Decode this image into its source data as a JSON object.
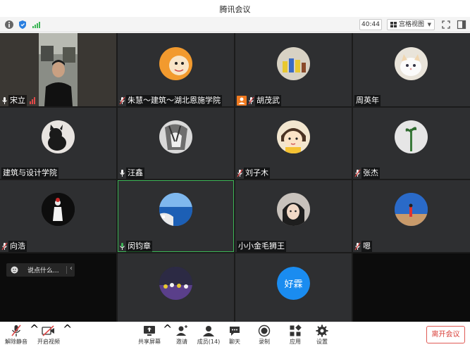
{
  "window": {
    "title": "腾讯会议"
  },
  "toolbar": {
    "icons": [
      "info-icon",
      "shield-icon",
      "signal-icon"
    ],
    "timer": "40:44",
    "layout_label": "宫格视图",
    "right_icons": [
      "fullscreen-icon",
      "sidebar-icon"
    ]
  },
  "participants": [
    {
      "name": "宋立",
      "mic": "on",
      "video": "camera",
      "signal": true
    },
    {
      "name": "朱慧～建筑～湖北恩施学院",
      "mic": "muted",
      "avatar": "orange-cartoon"
    },
    {
      "name": "胡茂武",
      "mic": "muted",
      "host_badge": true,
      "avatar": "figures"
    },
    {
      "name": "周英年",
      "mic": "none",
      "avatar": "cat"
    },
    {
      "name": "建筑与设计学院",
      "mic": "none",
      "avatar": "black-cat"
    },
    {
      "name": "汪鑫",
      "mic": "on",
      "avatar": "anime-bw"
    },
    {
      "name": "刘子木",
      "mic": "muted",
      "avatar": "cartoon-girl"
    },
    {
      "name": "张杰",
      "mic": "muted",
      "avatar": "plant"
    },
    {
      "name": "向浩",
      "mic": "muted",
      "avatar": "dark-figure"
    },
    {
      "name": "闵钧章",
      "mic": "active",
      "avatar": "sea-coast",
      "active_speaker": true
    },
    {
      "name": "小小金毛狮王",
      "mic": "none",
      "avatar": "person"
    },
    {
      "name": "嗯",
      "mic": "muted",
      "avatar": "sky-person"
    },
    {
      "name": "",
      "mic": "none",
      "avatar": "crowd"
    },
    {
      "name": "",
      "mic": "none",
      "avatar_text": "好霖",
      "avatar_color": "#1a8cf0"
    }
  ],
  "chat": {
    "placeholder": "说点什么..."
  },
  "bottombar": {
    "unmute": "解除静音",
    "start_video": "开启视频",
    "share_screen": "共享屏幕",
    "invite": "邀请",
    "members": "成员(14)",
    "chat": "聊天",
    "record": "录制",
    "apps": "应用",
    "settings": "设置",
    "leave": "离开会议"
  },
  "colors": {
    "tile_bg": "#2e2f31",
    "active_outline": "#3cb556",
    "leave_red": "#d9403a",
    "accent_blue": "#1a8cf0"
  }
}
